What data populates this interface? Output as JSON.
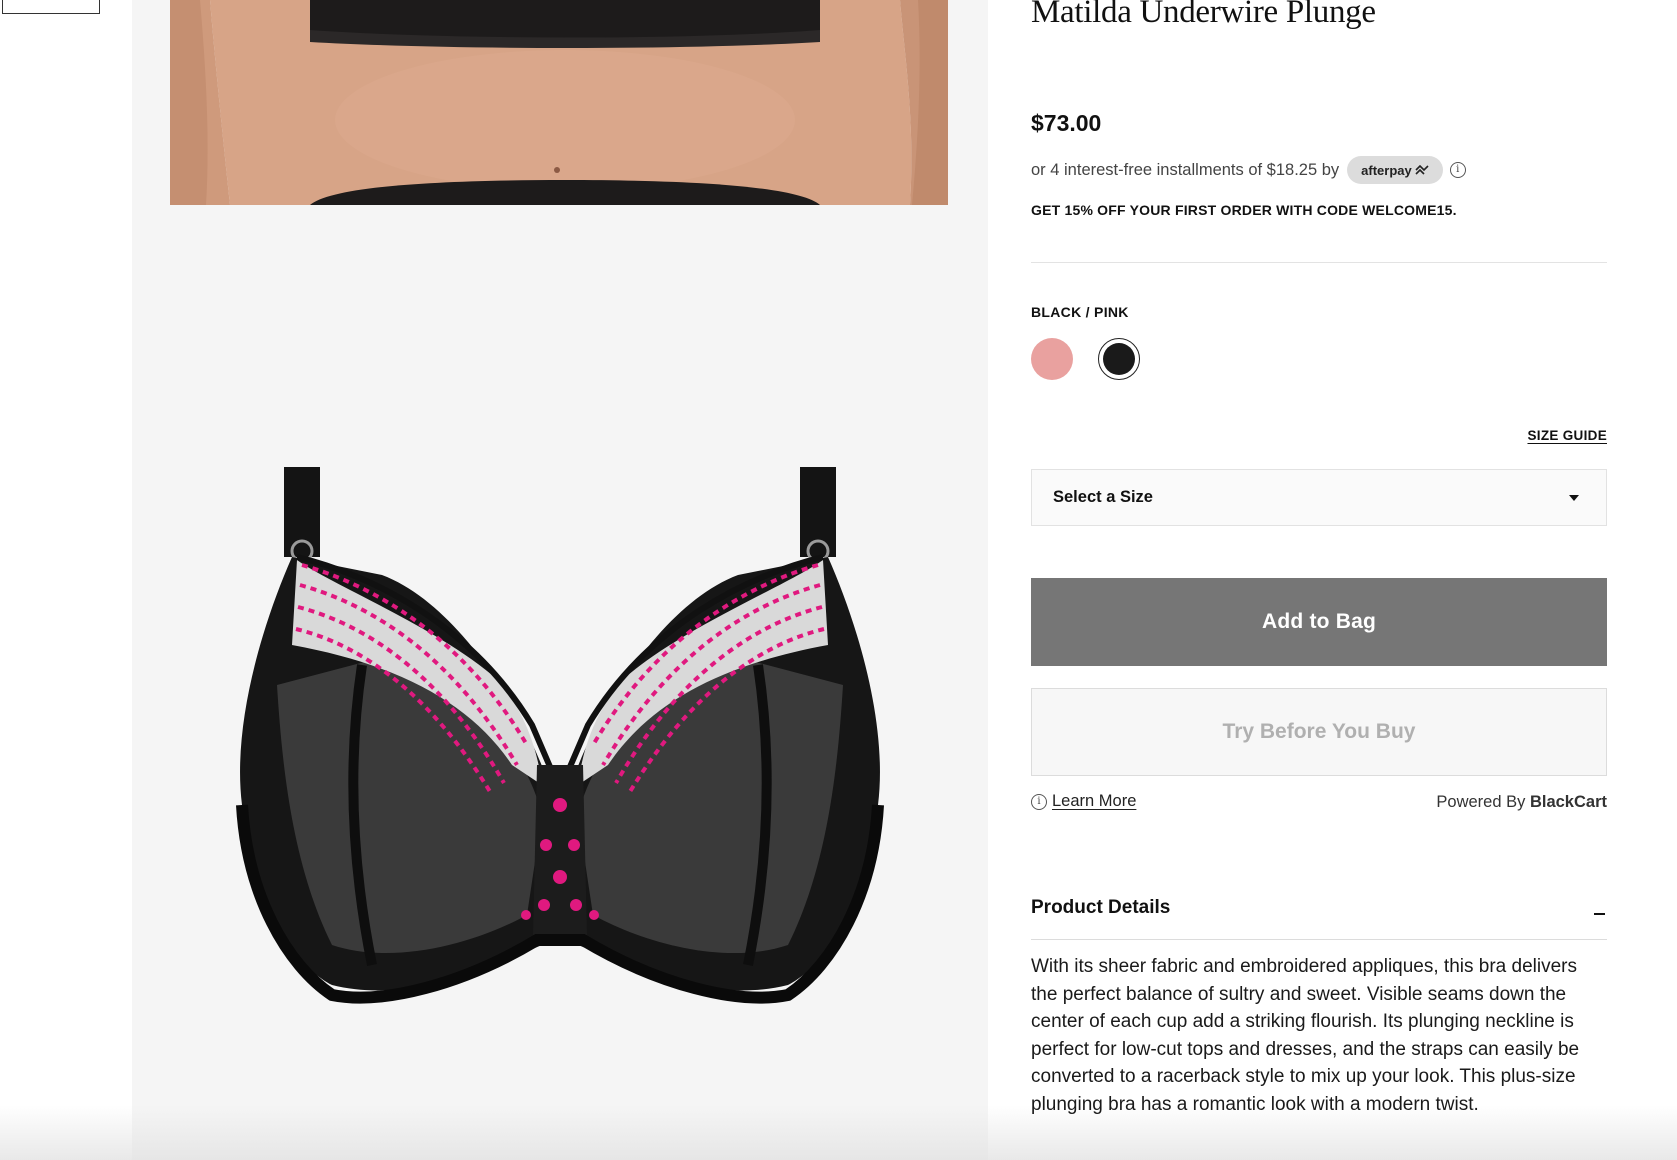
{
  "product": {
    "title": "Matilda Underwire Plunge",
    "price": "$73.00",
    "installments_text": "or 4 interest-free installments of $18.25 by",
    "afterpay_label": "afterpay",
    "promo_text": "GET 15% OFF YOUR FIRST ORDER WITH CODE WELCOME15."
  },
  "color": {
    "selected_label": "BLACK / PINK",
    "swatches": [
      {
        "name": "pink",
        "hex": "#e9a19f"
      },
      {
        "name": "black",
        "hex": "#1a1a1a"
      }
    ]
  },
  "size": {
    "guide_label": "SIZE GUIDE",
    "select_label": "Select a Size"
  },
  "actions": {
    "add_to_bag": "Add to Bag",
    "try_before": "Try Before You Buy",
    "learn_more": "Learn More",
    "powered_prefix": "Powered By",
    "powered_brand": "BlackCart"
  },
  "details": {
    "heading": "Product Details",
    "body": "With its sheer fabric and embroidered appliques, this bra delivers the perfect balance of sultry and sweet. Visible seams down the center of each cup add a striking flourish. Its plunging neckline is perfect for low-cut tops and dresses, and the straps can easily be converted to a racerback style to mix up your look. This plus-size plunging bra has a romantic look with a modern twist."
  },
  "colors": {
    "add_button_bg": "#767676",
    "gallery_bg": "#f5f5f5",
    "accent_pink": "#e0197f"
  }
}
